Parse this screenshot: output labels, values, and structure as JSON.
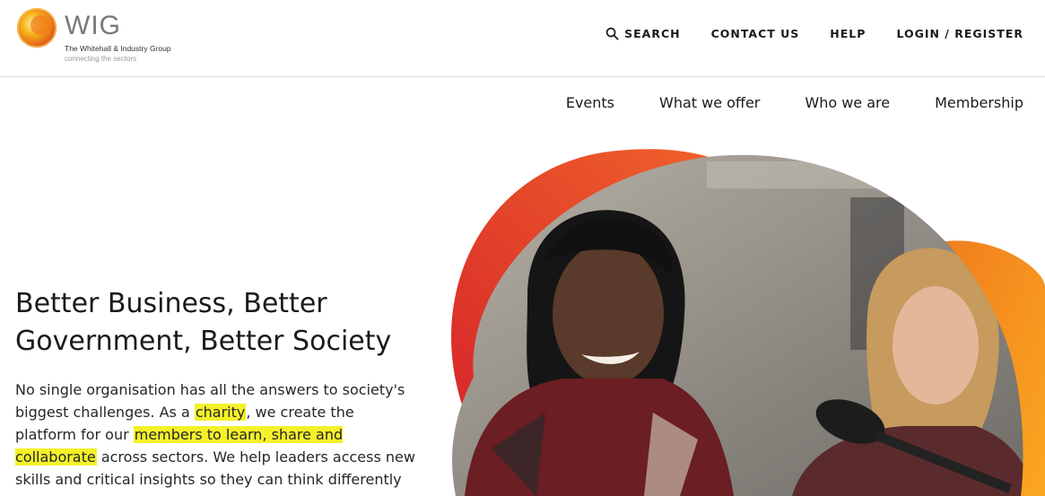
{
  "brand": {
    "name": "WIG",
    "full_name": "The Whitehall & Industry Group",
    "tagline": "connecting the sectors"
  },
  "utility_nav": {
    "search": "SEARCH",
    "contact": "CONTACT US",
    "help": "HELP",
    "login": "LOGIN / REGISTER"
  },
  "main_nav": {
    "items": [
      "Events",
      "What we offer",
      "Who we are",
      "Membership"
    ]
  },
  "hero": {
    "title_line1": "Better Business, Better",
    "title_line2": "Government, Better Society",
    "body_1": "No single organisation has all the answers to society's biggest challenges. As a ",
    "link_charity": "charity",
    "body_2": ", we create the platform for our ",
    "link_members": "members to learn, share and collaborate",
    "body_3": " across sectors. We help leaders access new skills and critical insights so they can think differently and lead effectively."
  },
  "colors": {
    "highlight": "#f4f12a",
    "blob_red": "#e0342a",
    "blob_orange": "#f39a1f",
    "text": "#1a1a1a"
  },
  "icons": {
    "search": "search-icon",
    "logo": "wig-logo-icon"
  }
}
